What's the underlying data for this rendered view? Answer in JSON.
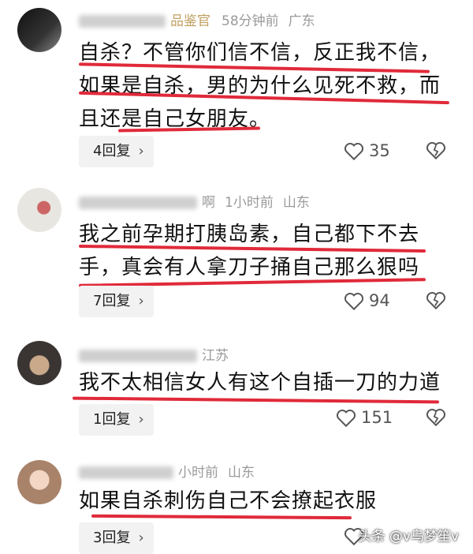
{
  "comments": [
    {
      "meta_badge": "品鉴官",
      "meta_time": "58分钟前",
      "meta_location": "广东",
      "lines": [
        "自杀？不管你们信不信，反正我不信，",
        "如果是自杀，男的为什么见死不救，而",
        "且还是自己女朋友。"
      ],
      "reply_label": "4回复",
      "likes": "35"
    },
    {
      "meta_partial": "啊",
      "meta_time": "1小时前",
      "meta_location": "山东",
      "lines": [
        "我之前孕期打胰岛素，自己都下不去",
        "手，真会有人拿刀子捅自己那么狠吗"
      ],
      "reply_label": "7回复",
      "likes": "94"
    },
    {
      "meta_location": "江苏",
      "lines": [
        "我不太相信女人有这个自插一刀的力道"
      ],
      "reply_label": "1回复",
      "likes": "151"
    },
    {
      "meta_time": "小时前",
      "meta_location": "山东",
      "lines": [
        "如果自杀刺伤自己不会撩起衣服"
      ],
      "reply_label": "3回复"
    }
  ],
  "icons": {
    "like": "heart-outline-icon",
    "dislike": "broken-heart-icon",
    "reply_chevron": "chevron-right-icon"
  },
  "watermark": "头条 @v乌梦笙v",
  "colors": {
    "underline": "#e02a3a",
    "meta": "#9a9a9a",
    "badge": "#c0a060"
  }
}
